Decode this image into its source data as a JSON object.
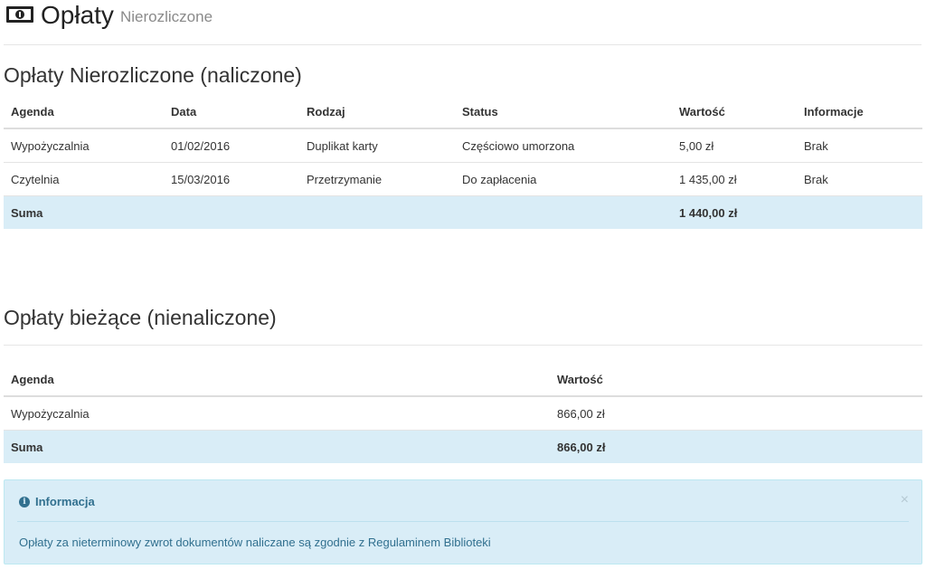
{
  "header": {
    "title": "Opłaty",
    "subtitle": "Nierozliczone",
    "icon": "money-bill-icon"
  },
  "section_charged": {
    "title": "Opłaty Nierozliczone (naliczone)",
    "columns": [
      "Agenda",
      "Data",
      "Rodzaj",
      "Status",
      "Wartość",
      "Informacje"
    ],
    "rows": [
      {
        "agenda": "Wypożyczalnia",
        "date": "01/02/2016",
        "type": "Duplikat karty",
        "status": "Częściowo umorzona",
        "value": "5,00 zł",
        "info": "Brak"
      },
      {
        "agenda": "Czytelnia",
        "date": "15/03/2016",
        "type": "Przetrzymanie",
        "status": "Do zapłacenia",
        "value": "1 435,00 zł",
        "info": "Brak"
      }
    ],
    "sum_label": "Suma",
    "sum_value": "1 440,00 zł"
  },
  "section_current": {
    "title": "Opłaty bieżące (nienaliczone)",
    "columns": [
      "Agenda",
      "Wartość"
    ],
    "rows": [
      {
        "agenda": "Wypożyczalnia",
        "value": "866,00 zł"
      }
    ],
    "sum_label": "Suma",
    "sum_value": "866,00 zł"
  },
  "alert": {
    "title": "Informacja",
    "close": "×",
    "body": "Opłaty za nieterminowy zwrot dokumentów naliczane są zgodnie z Regulaminem Biblioteki",
    "icon": "info-circle-icon"
  },
  "colors": {
    "sum_row_bg": "#d9edf7",
    "alert_bg": "#d9edf7",
    "alert_text": "#31708f"
  }
}
